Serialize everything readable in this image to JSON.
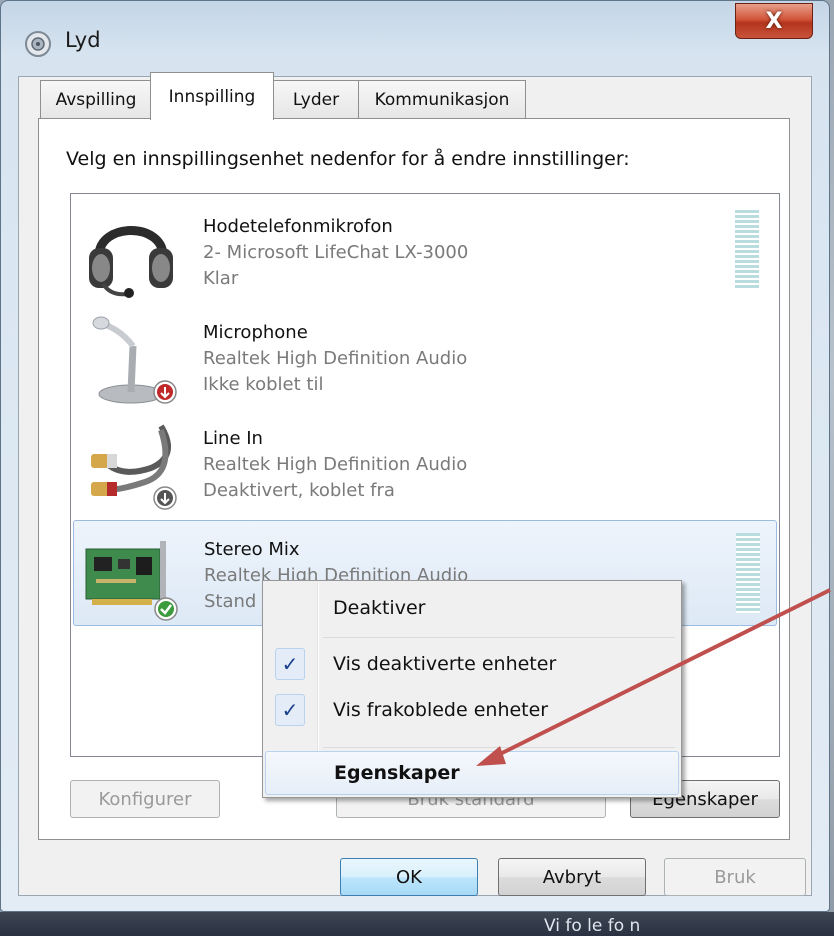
{
  "window": {
    "title": "Lyd",
    "close_label": "X"
  },
  "tabs": [
    {
      "label": "Avspilling",
      "active": false
    },
    {
      "label": "Innspilling",
      "active": true
    },
    {
      "label": "Lyder",
      "active": false
    },
    {
      "label": "Kommunikasjon",
      "active": false
    }
  ],
  "instruction": "Velg en innspillingsenhet nedenfor for å endre innstillinger:",
  "devices": [
    {
      "name": "Hodetelefonmikrofon",
      "driver": "2- Microsoft LifeChat LX-3000",
      "status": "Klar",
      "icon": "headset-icon",
      "badge": ""
    },
    {
      "name": "Microphone",
      "driver": "Realtek High Definition Audio",
      "status": "Ikke koblet til",
      "icon": "microphone-icon",
      "badge": "unplugged-badge"
    },
    {
      "name": "Line In",
      "driver": "Realtek High Definition Audio",
      "status": "Deaktivert, koblet fra",
      "icon": "line-in-cable-icon",
      "badge": "disabled-badge"
    },
    {
      "name": "Stereo Mix",
      "driver": "Realtek High Definition Audio",
      "status": "Stand",
      "icon": "sound-card-icon",
      "badge": "default-check-badge"
    }
  ],
  "buttons": {
    "configure": "Konfigurer",
    "set_default": "Bruk standard",
    "properties": "Egenskaper",
    "ok": "OK",
    "cancel": "Avbryt",
    "apply": "Bruk"
  },
  "context_menu": {
    "items": [
      {
        "label": "Deaktiver",
        "checked": false
      },
      {
        "label": "Vis deaktiverte enheter",
        "checked": true
      },
      {
        "label": "Vis frakoblede enheter",
        "checked": true
      },
      {
        "label": "Egenskaper",
        "checked": false,
        "bold": true
      }
    ],
    "check_glyph": "✓"
  },
  "background": {
    "taskbar_text": "Vi fo le fo n"
  },
  "colors": {
    "arrow": "#c0504d",
    "selection": "#dde9f6",
    "close": "#c9533a"
  }
}
